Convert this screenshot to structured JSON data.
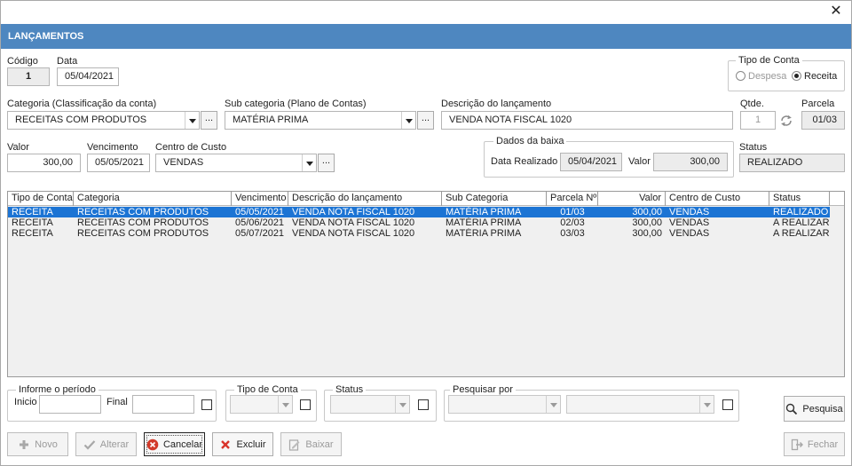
{
  "window": {
    "close_glyph": "✕",
    "title": "LANÇAMENTOS"
  },
  "header": {
    "codigo_label": "Código",
    "codigo_value": "1",
    "data_label": "Data",
    "data_value": "05/04/2021",
    "tipo_conta": {
      "title": "Tipo de Conta",
      "despesa": "Despesa",
      "receita": "Receita",
      "selected": "Receita"
    }
  },
  "row2": {
    "categoria_label": "Categoria (Classificação da conta)",
    "categoria_value": "RECEITAS COM PRODUTOS",
    "subcat_label": "Sub categoria (Plano de Contas)",
    "subcat_value": "MATÉRIA PRIMA",
    "descricao_label": "Descrição do lançamento",
    "descricao_value": "VENDA NOTA FISCAL 1020",
    "qtde_label": "Qtde.",
    "qtde_value": "1",
    "parcela_label": "Parcela",
    "parcela_value": "01/03",
    "dots": "..."
  },
  "row3": {
    "valor_label": "Valor",
    "valor_value": "300,00",
    "vencimento_label": "Vencimento",
    "vencimento_value": "05/05/2021",
    "centro_label": "Centro de Custo",
    "centro_value": "VENDAS",
    "baixa": {
      "title": "Dados da baixa",
      "data_label": "Data Realizado",
      "data_value": "05/04/2021",
      "valor_label": "Valor",
      "valor_value": "300,00"
    },
    "status_label": "Status",
    "status_value": "REALIZADO"
  },
  "grid": {
    "columns": [
      "Tipo de Conta",
      "Categoria",
      "Vencimento",
      "Descrição do lançamento",
      "Sub Categoria",
      "Parcela Nº",
      "Valor",
      "Centro de Custo",
      "Status"
    ],
    "rows": [
      [
        "RECEITA",
        "RECEITAS COM PRODUTOS",
        "05/05/2021",
        "VENDA NOTA FISCAL 1020",
        "MATÉRIA PRIMA",
        "01/03",
        "300,00",
        "VENDAS",
        "REALIZADO"
      ],
      [
        "RECEITA",
        "RECEITAS COM PRODUTOS",
        "05/06/2021",
        "VENDA NOTA FISCAL 1020",
        "MATÉRIA PRIMA",
        "02/03",
        "300,00",
        "VENDAS",
        "A REALIZAR"
      ],
      [
        "RECEITA",
        "RECEITAS COM PRODUTOS",
        "05/07/2021",
        "VENDA NOTA FISCAL 1020",
        "MATÉRIA PRIMA",
        "03/03",
        "300,00",
        "VENDAS",
        "A REALIZAR"
      ]
    ],
    "selected_row": 0
  },
  "filters": {
    "periodo_title": "Informe o período",
    "inicio_label": "Inicio",
    "final_label": "Final",
    "tipo_title": "Tipo de Conta",
    "status_title": "Status",
    "pesquisar_title": "Pesquisar por",
    "pesquisa_button": "Pesquisa"
  },
  "toolbar": {
    "novo": "Novo",
    "alterar": "Alterar",
    "cancelar": "Cancelar",
    "excluir": "Excluir",
    "baixar": "Baixar",
    "fechar": "Fechar"
  },
  "colors": {
    "title_bar": "#4e87c0",
    "selection": "#1c74d4",
    "cancel_icon": "#d23a2a",
    "excluir_icon": "#d9342b"
  }
}
